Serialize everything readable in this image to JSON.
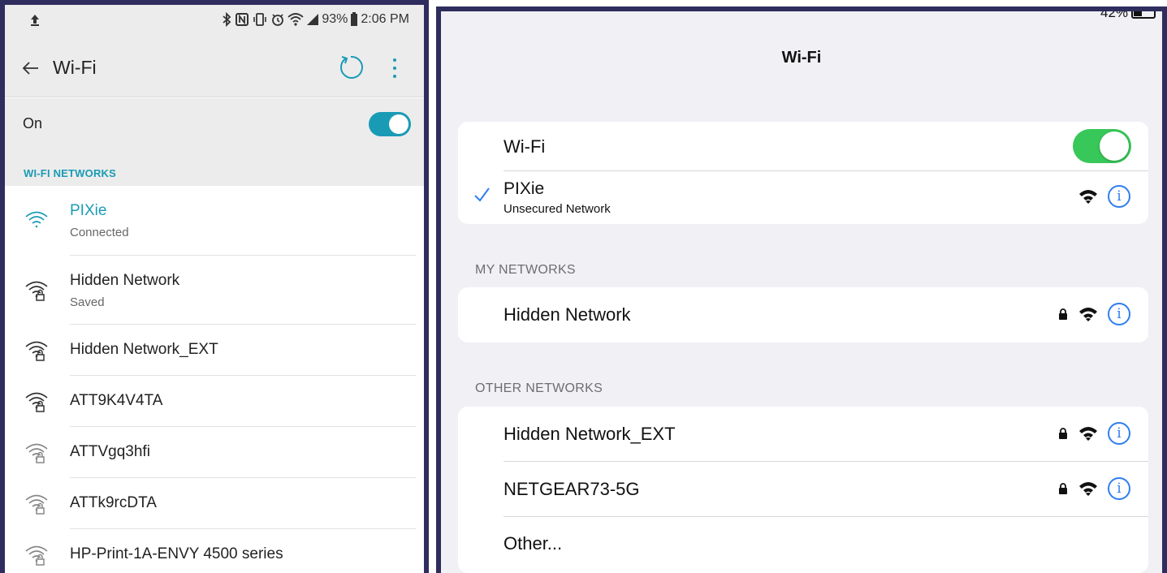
{
  "android": {
    "status": {
      "battery": "93%",
      "time": "2:06 PM"
    },
    "title": "Wi-Fi",
    "toggle_label": "On",
    "toggle_on": true,
    "section_header": "WI-FI NETWORKS",
    "networks": [
      {
        "name": "PIXie",
        "status": "Connected",
        "connected": true,
        "locked": false
      },
      {
        "name": "Hidden Network",
        "status": "Saved",
        "connected": false,
        "locked": true
      },
      {
        "name": "Hidden Network_EXT",
        "status": "",
        "connected": false,
        "locked": true
      },
      {
        "name": "ATT9K4V4TA",
        "status": "",
        "connected": false,
        "locked": true
      },
      {
        "name": "ATTVgq3hfi",
        "status": "",
        "connected": false,
        "locked": true
      },
      {
        "name": "ATTk9rcDTA",
        "status": "",
        "connected": false,
        "locked": true
      },
      {
        "name": "HP-Print-1A-ENVY 4500 series",
        "status": "",
        "connected": false,
        "locked": true
      }
    ],
    "accent": "#1a9bb5"
  },
  "ios": {
    "battery": "42%",
    "title": "Wi-Fi",
    "wifi_label": "Wi-Fi",
    "wifi_on": true,
    "current": {
      "name": "PIXie",
      "sub": "Unsecured Network"
    },
    "my_networks_header": "MY NETWORKS",
    "my_networks": [
      {
        "name": "Hidden Network",
        "locked": true
      }
    ],
    "other_networks_header": "OTHER NETWORKS",
    "other_networks": [
      {
        "name": "Hidden Network_EXT",
        "locked": true
      },
      {
        "name": "NETGEAR73-5G",
        "locked": true
      }
    ],
    "other_label": "Other...",
    "info_glyph": "i",
    "accent": "#2f7ef0",
    "toggle_color": "#38c759"
  }
}
